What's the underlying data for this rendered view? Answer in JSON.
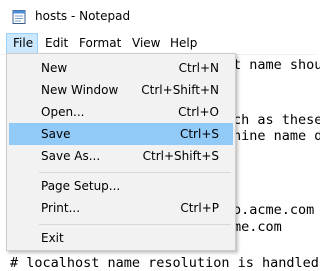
{
  "window": {
    "title": "hosts - Notepad"
  },
  "menubar": {
    "items": [
      {
        "label": "File"
      },
      {
        "label": "Edit"
      },
      {
        "label": "Format"
      },
      {
        "label": "View"
      },
      {
        "label": "Help"
      }
    ]
  },
  "file_menu": {
    "items": [
      {
        "label": "New",
        "shortcut": "Ctrl+N"
      },
      {
        "label": "New Window",
        "shortcut": "Ctrl+Shift+N"
      },
      {
        "label": "Open...",
        "shortcut": "Ctrl+O"
      },
      {
        "label": "Save",
        "shortcut": "Ctrl+S"
      },
      {
        "label": "Save As...",
        "shortcut": "Ctrl+Shift+S"
      },
      {
        "label": "Page Setup...",
        "shortcut": ""
      },
      {
        "label": "Print...",
        "shortcut": "Ctrl+P"
      },
      {
        "label": "Exit",
        "shortcut": ""
      }
    ]
  },
  "editor": {
    "lines": [
      "t name shou",
      "ch as these",
      "hine name d",
      "o.acme.com",
      "me.com",
      "# localhost name resolution is handled"
    ]
  },
  "colors": {
    "highlight": "#91c9f7",
    "menu_active": "#cce8ff",
    "menu_bg": "#f2f2f2"
  },
  "icons": {
    "app": "notepad-icon"
  }
}
